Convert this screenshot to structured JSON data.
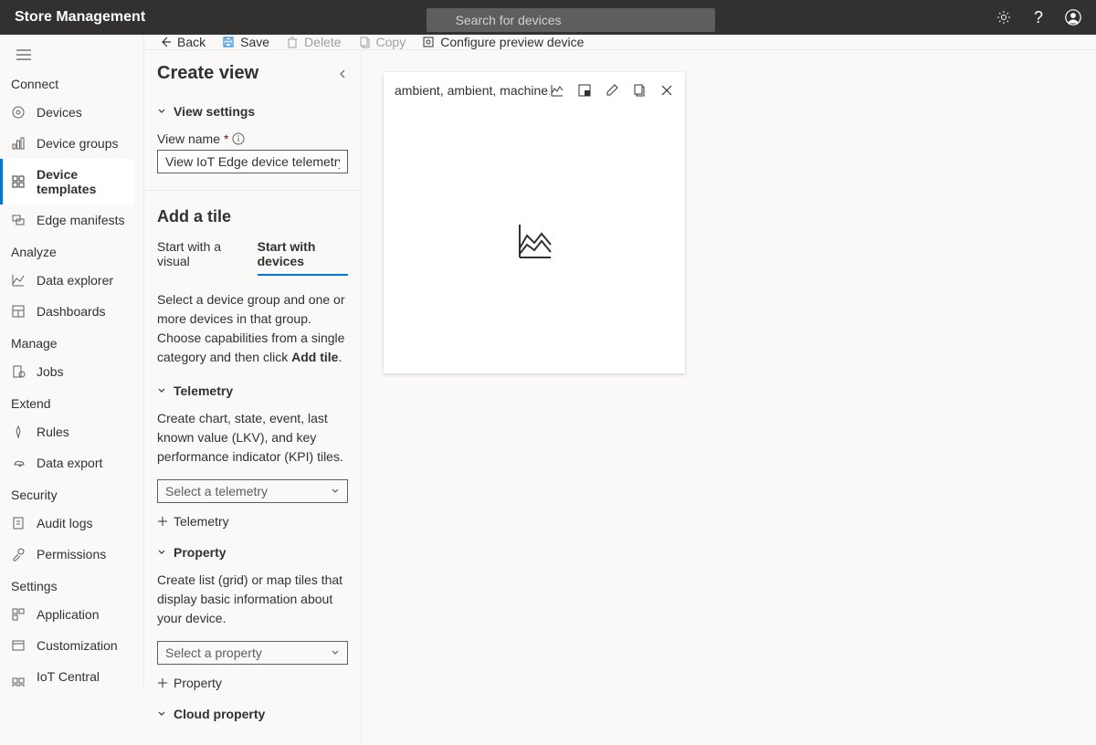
{
  "header": {
    "title": "Store Management",
    "searchPlaceholder": "Search for devices"
  },
  "sidebar": {
    "sections": [
      {
        "label": "Connect",
        "items": [
          {
            "icon": "devices",
            "label": "Devices"
          },
          {
            "icon": "device-groups",
            "label": "Device groups"
          },
          {
            "icon": "device-templates",
            "label": "Device templates",
            "active": true
          },
          {
            "icon": "edge-manifests",
            "label": "Edge manifests"
          }
        ]
      },
      {
        "label": "Analyze",
        "items": [
          {
            "icon": "data-explorer",
            "label": "Data explorer"
          },
          {
            "icon": "dashboards",
            "label": "Dashboards"
          }
        ]
      },
      {
        "label": "Manage",
        "items": [
          {
            "icon": "jobs",
            "label": "Jobs"
          }
        ]
      },
      {
        "label": "Extend",
        "items": [
          {
            "icon": "rules",
            "label": "Rules"
          },
          {
            "icon": "data-export",
            "label": "Data export"
          }
        ]
      },
      {
        "label": "Security",
        "items": [
          {
            "icon": "audit-logs",
            "label": "Audit logs"
          },
          {
            "icon": "permissions",
            "label": "Permissions"
          }
        ]
      },
      {
        "label": "Settings",
        "items": [
          {
            "icon": "application",
            "label": "Application"
          },
          {
            "icon": "customization",
            "label": "Customization"
          },
          {
            "icon": "iot-central-home",
            "label": "IoT Central Home"
          }
        ]
      }
    ]
  },
  "toolbar": {
    "back": "Back",
    "save": "Save",
    "delete": "Delete",
    "copy": "Copy",
    "configure": "Configure preview device"
  },
  "leftPane": {
    "title": "Create view",
    "viewSettings": "View settings",
    "viewNameLabel": "View name",
    "viewNameValue": "View IoT Edge device telemetry",
    "addTileTitle": "Add a tile",
    "tabs": {
      "visual": "Start with a visual",
      "devices": "Start with devices"
    },
    "addTileDesc": "Select a device group and one or more devices in that group. Choose capabilities from a single category and then click ",
    "addTileDescBold": "Add tile",
    "telemetry": {
      "label": "Telemetry",
      "desc": "Create chart, state, event, last known value (LKV), and key performance indicator (KPI) tiles.",
      "placeholder": "Select a telemetry",
      "addLabel": "Telemetry"
    },
    "property": {
      "label": "Property",
      "desc": "Create list (grid) or map tiles that display basic information about your device.",
      "placeholder": "Select a property",
      "addLabel": "Property"
    },
    "cloudProperty": {
      "label": "Cloud property"
    }
  },
  "tile": {
    "title": "ambient, ambient, machine, macl"
  }
}
